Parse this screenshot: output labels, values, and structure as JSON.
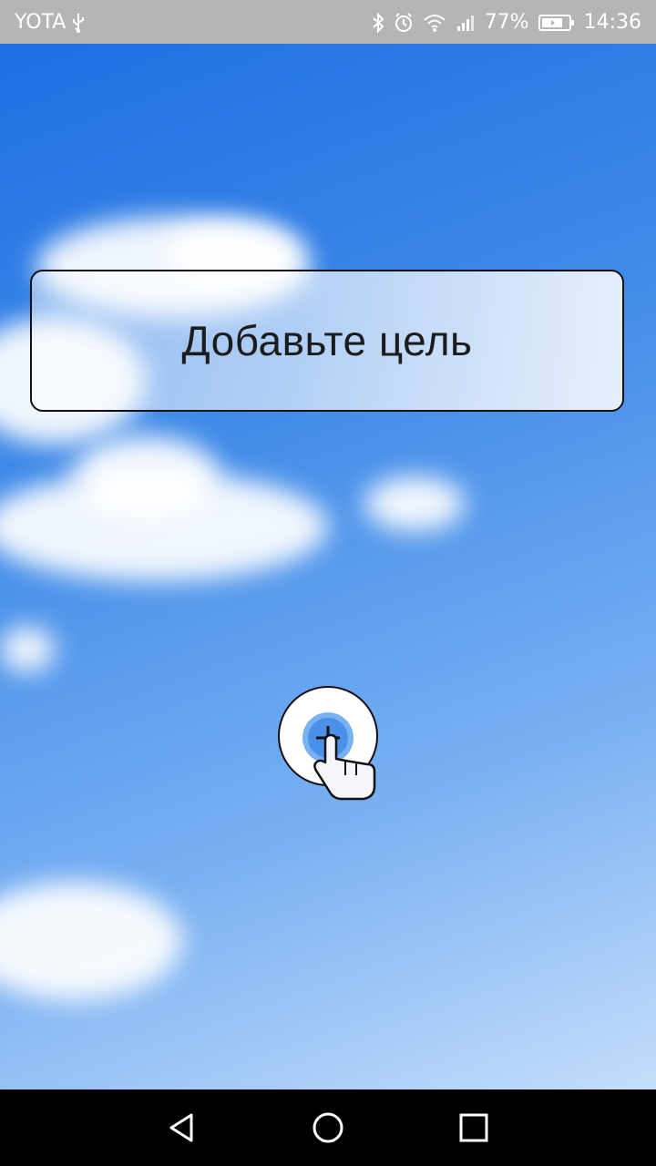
{
  "status_bar": {
    "carrier": "YOTA",
    "battery_percent": "77%",
    "time": "14:36",
    "icons": [
      "usb-icon",
      "bluetooth-icon",
      "alarm-icon",
      "wifi-icon",
      "signal-icon",
      "battery-icon"
    ]
  },
  "main": {
    "goal_prompt": "Добавьте цель",
    "add_button_icon": "add-with-tap-hand-icon"
  },
  "nav_bar": {
    "icons": [
      "back-icon",
      "home-icon",
      "recents-icon"
    ]
  },
  "colors": {
    "sky_top": "#1e6fe3",
    "sky_bottom": "#c4ddfb",
    "status_bar": "#b5b5b5",
    "nav_bar": "#000000"
  }
}
